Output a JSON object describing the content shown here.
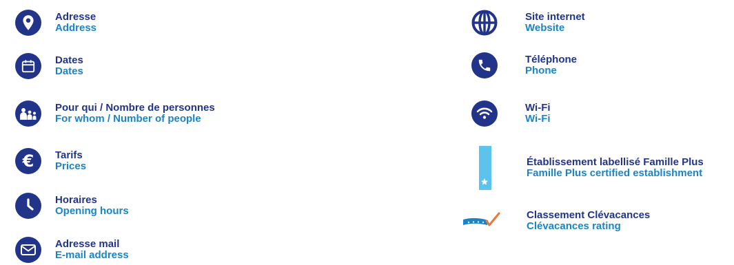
{
  "colors": {
    "icon_navy": "#22348a",
    "label_navy": "#22348a",
    "label_blue": "#1b84c6",
    "famille_plus_blue": "#5cc3ec",
    "clevacances_orange": "#e8783a"
  },
  "left_column": [
    {
      "icon": "map-pin-icon",
      "fr": "Adresse",
      "en": "Address"
    },
    {
      "icon": "calendar-icon",
      "fr": "Dates",
      "en": "Dates"
    },
    {
      "icon": "people-icon",
      "fr": "Pour qui / Nombre de personnes",
      "en": "For whom / Number of people"
    },
    {
      "icon": "euro-icon",
      "fr": "Tarifs",
      "en": "Prices"
    },
    {
      "icon": "clock-icon",
      "fr": "Horaires",
      "en": "Opening hours"
    },
    {
      "icon": "envelope-icon",
      "fr": "Adresse mail",
      "en": "E-mail address"
    }
  ],
  "right_column": [
    {
      "icon": "globe-icon",
      "fr": "Site internet",
      "en": "Website"
    },
    {
      "icon": "phone-icon",
      "fr": "Téléphone",
      "en": "Phone"
    },
    {
      "icon": "wifi-icon",
      "fr": "Wi-Fi",
      "en": "Wi-Fi"
    },
    {
      "icon": "famille-plus-icon",
      "fr": "Établissement labellisé Famille Plus",
      "en": "Famille Plus certified establishment"
    },
    {
      "icon": "clevacances-icon",
      "fr": "Classement Clévacances",
      "en": "Clévacances rating"
    }
  ]
}
